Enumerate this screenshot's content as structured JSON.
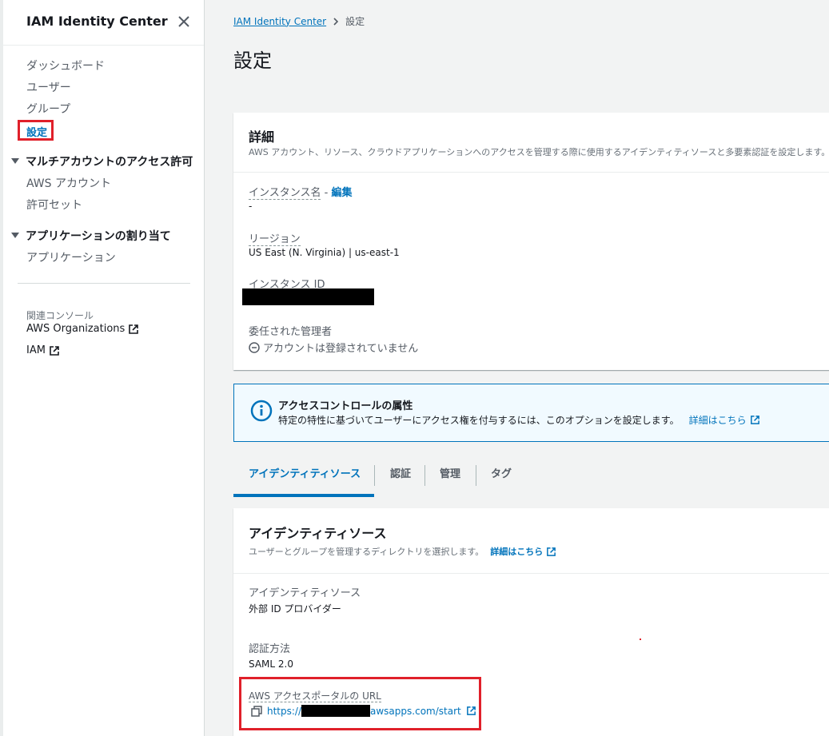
{
  "sidebar": {
    "title": "IAM Identity Center",
    "items": {
      "dashboard": "ダッシュボード",
      "users": "ユーザー",
      "groups": "グループ",
      "settings": "設定"
    },
    "section_multi_account": {
      "label": "マルチアカウントのアクセス許可",
      "items": {
        "aws_accounts": "AWS アカウント",
        "permission_sets": "許可セット"
      }
    },
    "section_applications": {
      "label": "アプリケーションの割り当て",
      "items": {
        "applications": "アプリケーション"
      }
    },
    "related_label": "関連コンソール",
    "related": {
      "organizations": "AWS Organizations",
      "iam": "IAM"
    }
  },
  "breadcrumb": {
    "root": "IAM Identity Center",
    "current": "設定"
  },
  "page_title": "設定",
  "details": {
    "title": "詳細",
    "description": "AWS アカウント、リソース、クラウドアプリケーションへのアクセスを管理する際に使用するアイデンティティソースと多要素認証を設定します。",
    "instance_name_label": "インスタンス名",
    "instance_name_sep": " - ",
    "edit_link": "編集",
    "instance_name_value": "-",
    "region_label": "リージョン",
    "region_value": "US East (N. Virginia) | us-east-1",
    "instance_id_label": "インスタンス ID",
    "delegated_admin_label": "委任された管理者",
    "delegated_admin_value": "アカウントは登録されていません"
  },
  "info": {
    "title": "アクセスコントロールの属性",
    "body": "特定の特性に基づいてユーザーにアクセス権を付与するには、このオプションを設定します。",
    "link": "詳細はこちら"
  },
  "tabs": {
    "identity_source": "アイデンティティソース",
    "authentication": "認証",
    "management": "管理",
    "tags": "タグ"
  },
  "identity_card": {
    "title": "アイデンティティソース",
    "description": "ユーザーとグループを管理するディレクトリを選択します。",
    "learn_more": "詳細はこちら",
    "source_label": "アイデンティティソース",
    "source_value": "外部 ID プロバイダー",
    "auth_label": "認証方法",
    "auth_value": "SAML 2.0",
    "portal_label": "AWS アクセスポータルの URL",
    "portal_url_prefix": "https://",
    "portal_url_suffix": "awsapps.com/start"
  },
  "colors": {
    "link": "#0073bb",
    "highlight": "#e0202a",
    "info_bg": "#f1faff"
  }
}
